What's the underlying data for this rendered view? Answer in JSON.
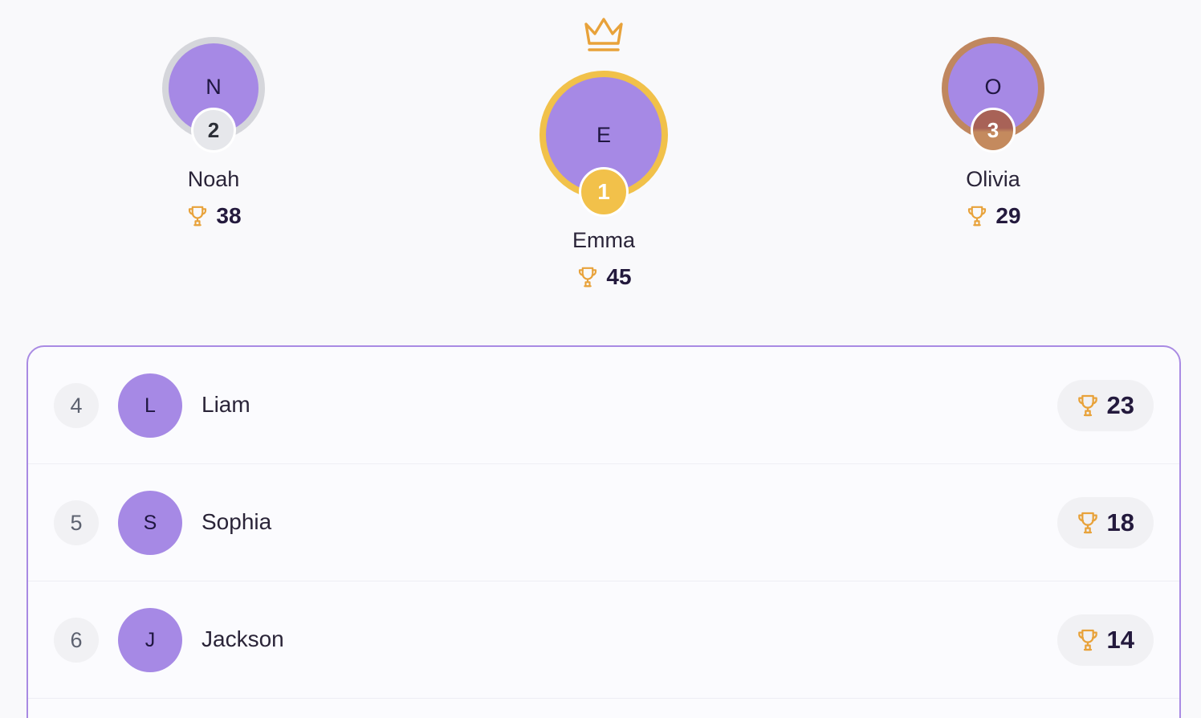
{
  "colors": {
    "accent": "#a689e5",
    "gold": "#f1c14a",
    "silver": "#d5d6db",
    "bronze": "#c0875f",
    "trophy": "#e8a23a"
  },
  "icons": {
    "crown": "crown-icon",
    "trophy": "trophy-icon"
  },
  "podium": {
    "first": {
      "initial": "E",
      "rank": "1",
      "name": "Emma",
      "score": "45"
    },
    "second": {
      "initial": "N",
      "rank": "2",
      "name": "Noah",
      "score": "38"
    },
    "third": {
      "initial": "O",
      "rank": "3",
      "name": "Olivia",
      "score": "29"
    }
  },
  "list": [
    {
      "rank": "4",
      "initial": "L",
      "name": "Liam",
      "score": "23"
    },
    {
      "rank": "5",
      "initial": "S",
      "name": "Sophia",
      "score": "18"
    },
    {
      "rank": "6",
      "initial": "J",
      "name": "Jackson",
      "score": "14"
    }
  ]
}
